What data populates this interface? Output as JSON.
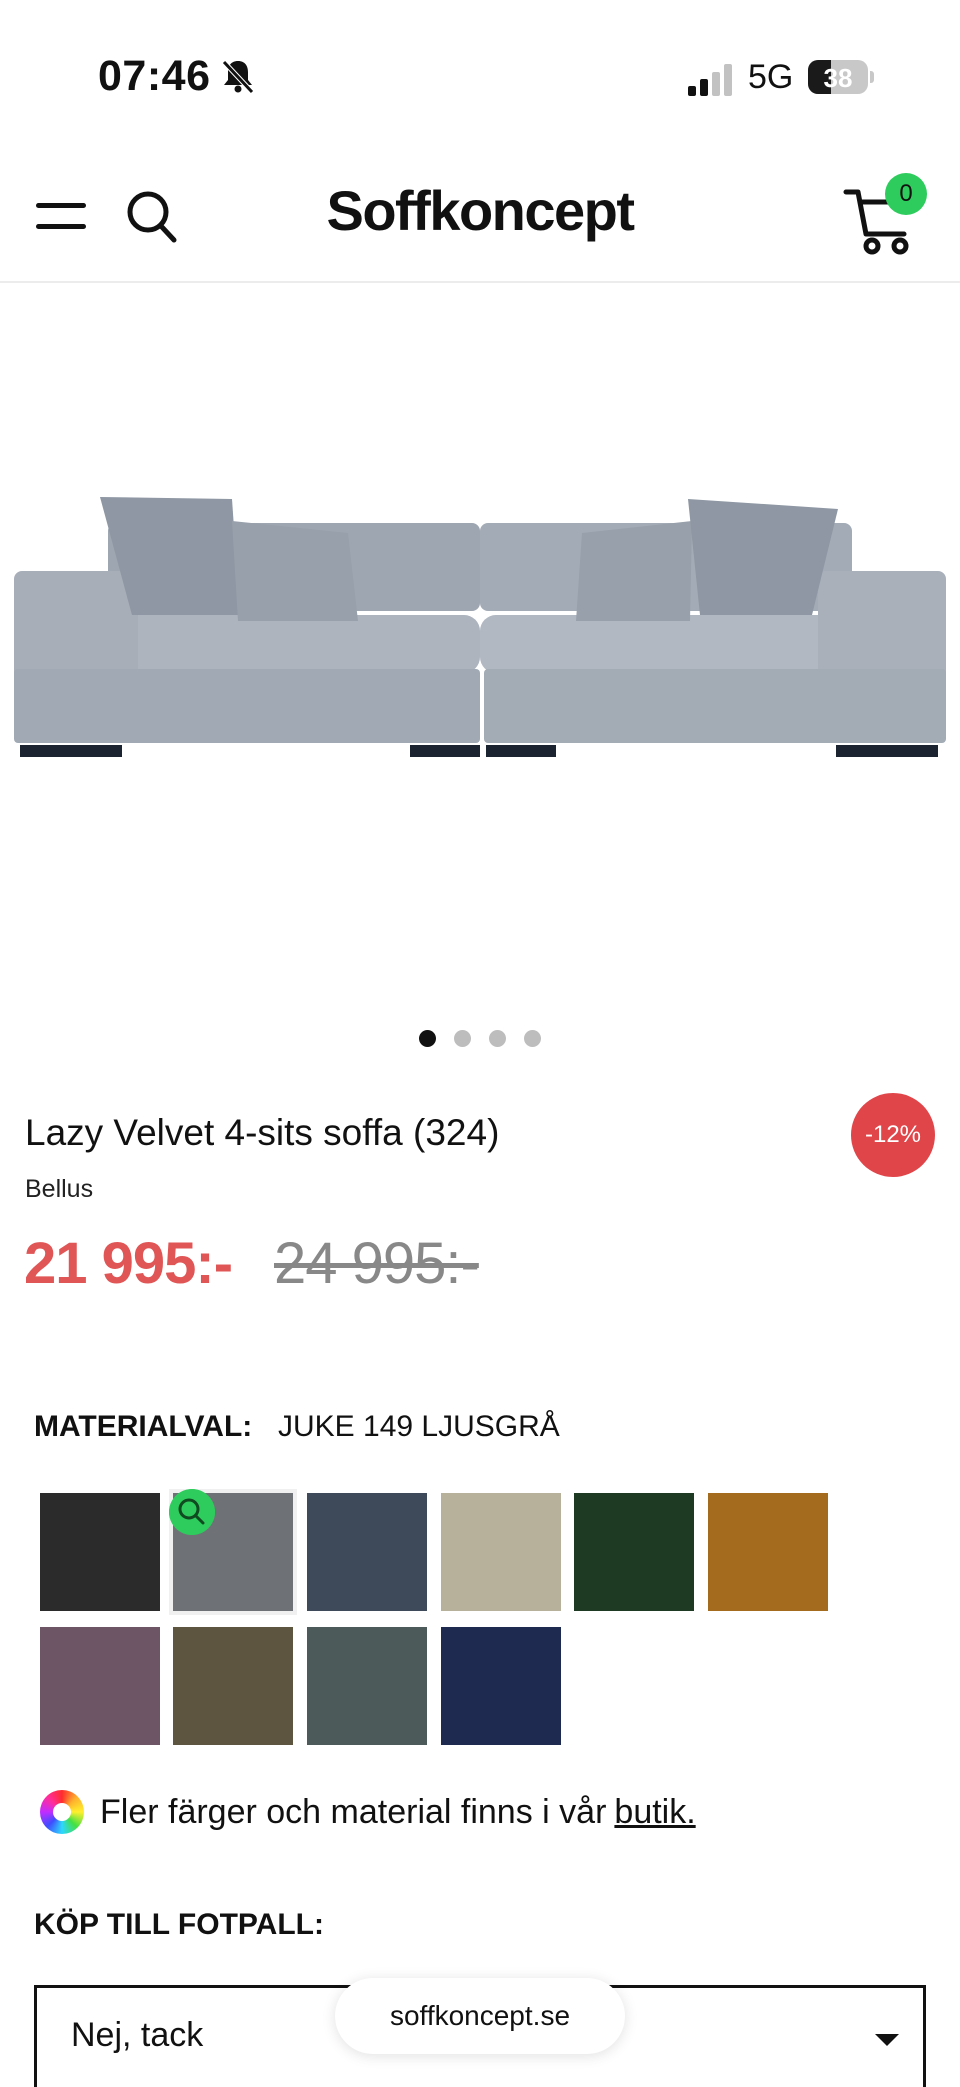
{
  "status_bar": {
    "time": "07:46",
    "network": "5G",
    "battery": "38",
    "battery_level": 0.38
  },
  "header": {
    "logo": "Soffkoncept",
    "cart_count": "0"
  },
  "gallery": {
    "slides": 4,
    "active_index": 0
  },
  "product": {
    "title": "Lazy Velvet 4-sits soffa (324)",
    "brand": "Bellus",
    "discount": "-12%",
    "sale_price": "21 995:-",
    "original_price": "24 995:-"
  },
  "material": {
    "label": "MATERIALVAL:",
    "selected": "JUKE 149 LJUSGRÅ",
    "swatches": [
      {
        "color": "#2b2b2b"
      },
      {
        "color": "#6e7276"
      },
      {
        "color": "#3e4a5a"
      },
      {
        "color": "#b7b19b"
      },
      {
        "color": "#1e3a22"
      },
      {
        "color": "#a46a1e"
      },
      {
        "color": "#6e5566"
      },
      {
        "color": "#5e5540"
      },
      {
        "color": "#4c5a5a"
      },
      {
        "color": "#1e2a50"
      }
    ]
  },
  "more_colors": {
    "text": "Fler färger och material finns i vår",
    "link": "butik."
  },
  "footstool": {
    "label": "KÖP TILL FOTPALL:",
    "selected": "Nej, tack"
  },
  "url_bar": {
    "domain": "soffkoncept.se"
  }
}
